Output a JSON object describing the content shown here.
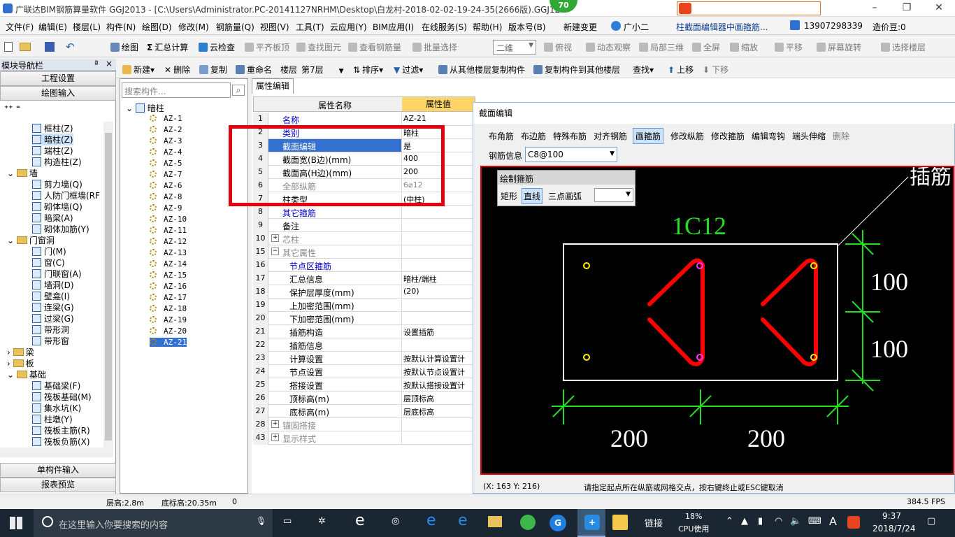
{
  "title": "广联达BIM钢筋算量软件 GGJ2013 - [C:\\Users\\Administrator.PC-20141127NRHM\\Desktop\\白龙村-2018-02-02-19-24-35(2666版).GGJ12",
  "badge": "70",
  "menus": [
    "文件(F)",
    "编辑(E)",
    "楼层(L)",
    "构件(N)",
    "绘图(D)",
    "修改(M)",
    "钢筋量(Q)",
    "视图(V)",
    "工具(T)",
    "云应用(Y)",
    "BIM应用(I)",
    "在线服务(S)",
    "帮助(H)",
    "版本号(B)",
    "新建变更",
    "广小二",
    "柱截面编辑器中画箍筋...",
    "13907298339",
    "造价豆:0"
  ],
  "toolbar1": [
    "绘图",
    "汇总计算",
    "云检查",
    "平齐板顶",
    "查找图元",
    "查看钢筋量",
    "批量选择",
    "二维",
    "俯视",
    "动态观察",
    "局部三维",
    "全屏",
    "缩放",
    "平移",
    "屏幕旋转",
    "选择楼层"
  ],
  "toolbar2": [
    "新建",
    "删除",
    "复制",
    "重命名",
    "楼层",
    "第7层",
    "排序",
    "过滤",
    "从其他楼层复制构件",
    "复制构件到其他楼层",
    "查找",
    "上移",
    "下移"
  ],
  "nav": {
    "title": "模块导航栏",
    "pin": "ª",
    "close": "×",
    "tabs": [
      "工程设置",
      "绘图输入"
    ],
    "bottom": [
      "单构件输入",
      "报表预览"
    ],
    "items": [
      "框柱(Z)",
      "暗柱(Z)",
      "端柱(Z)",
      "构造柱(Z)",
      "墙",
      "剪力墙(Q)",
      "人防门框墙(RF",
      "砌体墙(Q)",
      "暗梁(A)",
      "砌体加筋(Y)",
      "门窗洞",
      "门(M)",
      "窗(C)",
      "门联窗(A)",
      "墙洞(D)",
      "壁龛(I)",
      "连梁(G)",
      "过梁(G)",
      "带形洞",
      "带形窗",
      "梁",
      "板",
      "基础",
      "基础梁(F)",
      "筏板基础(M)",
      "集水坑(K)",
      "柱墩(Y)",
      "筏板主筋(R)",
      "筏板负筋(X)"
    ]
  },
  "search_placeholder": "搜索构件...",
  "tree_root": "暗柱",
  "components": [
    "AZ-1",
    "AZ-2",
    "AZ-3",
    "AZ-4",
    "AZ-5",
    "AZ-7",
    "AZ-6",
    "AZ-8",
    "AZ-9",
    "AZ-10",
    "AZ-11",
    "AZ-12",
    "AZ-13",
    "AZ-14",
    "AZ-15",
    "AZ-16",
    "AZ-17",
    "AZ-18",
    "AZ-19",
    "AZ-20",
    "AZ-21"
  ],
  "prop_tab": "属性编辑",
  "prop_headers": [
    "属性名称",
    "属性值"
  ],
  "props": [
    {
      "n": "1",
      "name": "名称",
      "val": "AZ-21"
    },
    {
      "n": "2",
      "name": "类别",
      "val": "暗柱"
    },
    {
      "n": "3",
      "name": "截面编辑",
      "val": "是"
    },
    {
      "n": "4",
      "name": "截面宽(B边)(mm)",
      "val": "400"
    },
    {
      "n": "5",
      "name": "截面高(H边)(mm)",
      "val": "200"
    },
    {
      "n": "6",
      "name": "全部纵筋",
      "val": "6⌀12"
    },
    {
      "n": "7",
      "name": "柱类型",
      "val": "(中柱)"
    },
    {
      "n": "8",
      "name": "其它箍筋",
      "val": ""
    },
    {
      "n": "9",
      "name": "备注",
      "val": ""
    },
    {
      "n": "10",
      "name": "芯柱",
      "val": ""
    },
    {
      "n": "15",
      "name": "其它属性",
      "val": ""
    },
    {
      "n": "16",
      "name": "节点区箍筋",
      "val": ""
    },
    {
      "n": "17",
      "name": "汇总信息",
      "val": "暗柱/端柱"
    },
    {
      "n": "18",
      "name": "保护层厚度(mm)",
      "val": "(20)"
    },
    {
      "n": "19",
      "name": "上加密范围(mm)",
      "val": ""
    },
    {
      "n": "20",
      "name": "下加密范围(mm)",
      "val": ""
    },
    {
      "n": "21",
      "name": "插筋构造",
      "val": "设置插筋"
    },
    {
      "n": "22",
      "name": "插筋信息",
      "val": ""
    },
    {
      "n": "23",
      "name": "计算设置",
      "val": "按默认计算设置计"
    },
    {
      "n": "24",
      "name": "节点设置",
      "val": "按默认节点设置计"
    },
    {
      "n": "25",
      "name": "搭接设置",
      "val": "按默认搭接设置计"
    },
    {
      "n": "26",
      "name": "顶标高(m)",
      "val": "层顶标高"
    },
    {
      "n": "27",
      "name": "底标高(m)",
      "val": "层底标高"
    },
    {
      "n": "28",
      "name": "锚固搭接",
      "val": ""
    },
    {
      "n": "43",
      "name": "显示样式",
      "val": ""
    }
  ],
  "dialog": {
    "title": "截面编辑",
    "tools": [
      "布角筋",
      "布边筋",
      "特殊布筋",
      "对齐钢筋",
      "画箍筋",
      "修改纵筋",
      "修改箍筋",
      "编辑弯钩",
      "端头伸缩",
      "删除"
    ],
    "rebar_label": "钢筋信息",
    "rebar_value": "C8@100",
    "draw_title": "绘制箍筋",
    "draw_modes": [
      "矩形",
      "直线",
      "三点画弧"
    ],
    "label_top": "1C12",
    "label_corner": "插筋",
    "dims_v": [
      "100",
      "100"
    ],
    "dims_h": [
      "200",
      "200"
    ],
    "coords": "(X: 163 Y: 216)",
    "hint": "请指定起点所在纵筋或网格交点，按右键终止或ESC键取消"
  },
  "status": {
    "floor_h": "层高:2.8m",
    "bottom_h": "底标高:20.35m",
    "zero": "0",
    "fps": "384.5 FPS"
  },
  "taskbar": {
    "search": "在这里输入你要搜索的内容",
    "link": "链接",
    "cpu_pct": "18%",
    "cpu_label": "CPU使用",
    "ime": "A",
    "time": "9:37",
    "date": "2018/7/24"
  },
  "colors": {
    "rebar": "#ff0000",
    "dim": "#22dd22",
    "accent": "#d00000"
  }
}
